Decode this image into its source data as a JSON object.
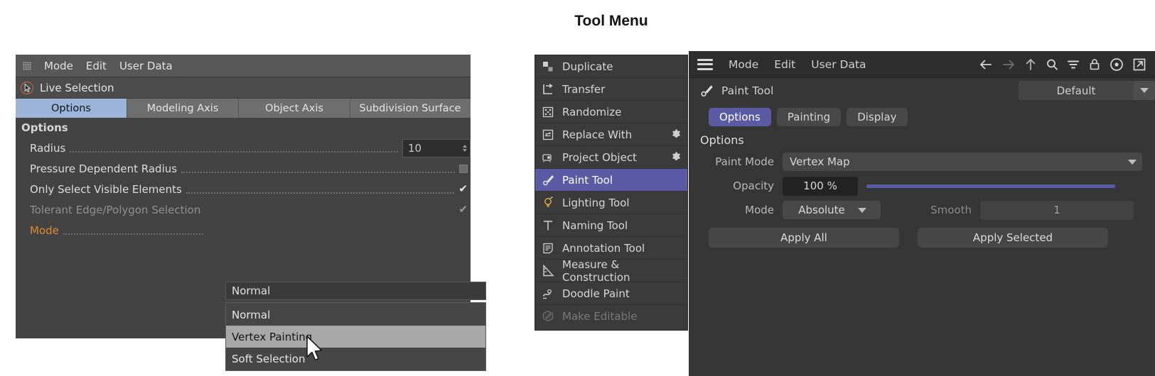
{
  "tool_menu": {
    "title": "Tool Menu",
    "items": [
      {
        "label": "Duplicate",
        "icon": "duplicate-icon",
        "state": "normal",
        "gear": false
      },
      {
        "label": "Transfer",
        "icon": "transfer-icon",
        "state": "normal",
        "gear": false
      },
      {
        "label": "Randomize",
        "icon": "randomize-icon",
        "state": "normal",
        "gear": false
      },
      {
        "label": "Replace With",
        "icon": "replace-icon",
        "state": "normal",
        "gear": true
      },
      {
        "label": "Project Object",
        "icon": "project-icon",
        "state": "normal",
        "gear": true
      },
      {
        "label": "Paint Tool",
        "icon": "brush-icon",
        "state": "selected",
        "gear": false
      },
      {
        "label": "Lighting Tool",
        "icon": "bulb-icon",
        "state": "normal",
        "gear": false
      },
      {
        "label": "Naming Tool",
        "icon": "text-t-icon",
        "state": "normal",
        "gear": false
      },
      {
        "label": "Annotation Tool",
        "icon": "note-icon",
        "state": "normal",
        "gear": false
      },
      {
        "label": "Measure & Construction",
        "icon": "ruler-icon",
        "state": "normal",
        "gear": false
      },
      {
        "label": "Doodle Paint",
        "icon": "doodle-icon",
        "state": "normal",
        "gear": false
      },
      {
        "label": "Make Editable",
        "icon": "make-editable-icon",
        "state": "disabled",
        "gear": false
      }
    ]
  },
  "left_panel": {
    "menu": {
      "grip": "grip-icon",
      "items": [
        "Mode",
        "Edit",
        "User Data"
      ]
    },
    "tool": {
      "icon": "live-selection-icon",
      "name": "Live Selection"
    },
    "tabs": [
      {
        "label": "Options",
        "active": true
      },
      {
        "label": "Modeling Axis",
        "active": false
      },
      {
        "label": "Object Axis",
        "active": false
      },
      {
        "label": "Subdivision Surface",
        "active": false
      }
    ],
    "section_title": "Options",
    "rows": [
      {
        "label": "Radius",
        "kind": "number",
        "value": "10",
        "state": "normal"
      },
      {
        "label": "Pressure Dependent Radius",
        "kind": "square",
        "value": "",
        "state": "normal"
      },
      {
        "label": "Only Select Visible Elements",
        "kind": "check",
        "value": "✔",
        "state": "normal"
      },
      {
        "label": "Tolerant Edge/Polygon Selection",
        "kind": "check",
        "value": "✔",
        "state": "dim"
      },
      {
        "label": "Mode",
        "kind": "combo",
        "value": "",
        "state": "accent"
      }
    ],
    "combo": {
      "selected": "Normal",
      "options": [
        {
          "label": "Normal",
          "highlighted": false
        },
        {
          "label": "Vertex Painting",
          "highlighted": true
        },
        {
          "label": "Soft Selection",
          "highlighted": false
        }
      ]
    },
    "cursor": "mouse-pointer"
  },
  "right_panel": {
    "menu": {
      "burger": "hamburger-icon",
      "items": [
        "Mode",
        "Edit",
        "User Data"
      ]
    },
    "icons": [
      {
        "name": "back-arrow-icon",
        "state": "normal"
      },
      {
        "name": "forward-arrow-icon",
        "state": "disabled"
      },
      {
        "name": "up-arrow-icon",
        "state": "normal"
      },
      {
        "name": "search-icon",
        "state": "normal"
      },
      {
        "name": "filter-icon",
        "state": "normal"
      },
      {
        "name": "lock-icon",
        "state": "normal"
      },
      {
        "name": "record-circle-icon",
        "state": "normal"
      },
      {
        "name": "external-link-icon",
        "state": "normal"
      }
    ],
    "tool": {
      "icon": "brush-icon",
      "name": "Paint Tool"
    },
    "preset": {
      "value": "Default",
      "caret": "chevron-down-icon"
    },
    "tabs": [
      {
        "label": "Options",
        "active": true
      },
      {
        "label": "Painting",
        "active": false
      },
      {
        "label": "Display",
        "active": false
      }
    ],
    "section_title": "Options",
    "fields": {
      "paint_mode": {
        "label": "Paint Mode",
        "value": "Vertex Map",
        "caret": "chevron-down-icon"
      },
      "opacity": {
        "label": "Opacity",
        "value": "100 %",
        "slider_percent": 100,
        "slider_color": "#5b5ba5"
      },
      "mode": {
        "label": "Mode",
        "value": "Absolute",
        "caret": "chevron-down-icon"
      },
      "smooth": {
        "label": "Smooth",
        "value": "1",
        "disabled": true
      }
    },
    "buttons": [
      {
        "label": "Apply All"
      },
      {
        "label": "Apply Selected"
      }
    ]
  },
  "colors": {
    "accent_purple": "#5b5ba5",
    "tab_active_blue": "#9cb4d8",
    "label_orange": "#e08a2e",
    "highlight_gray": "#a8a8a8"
  }
}
